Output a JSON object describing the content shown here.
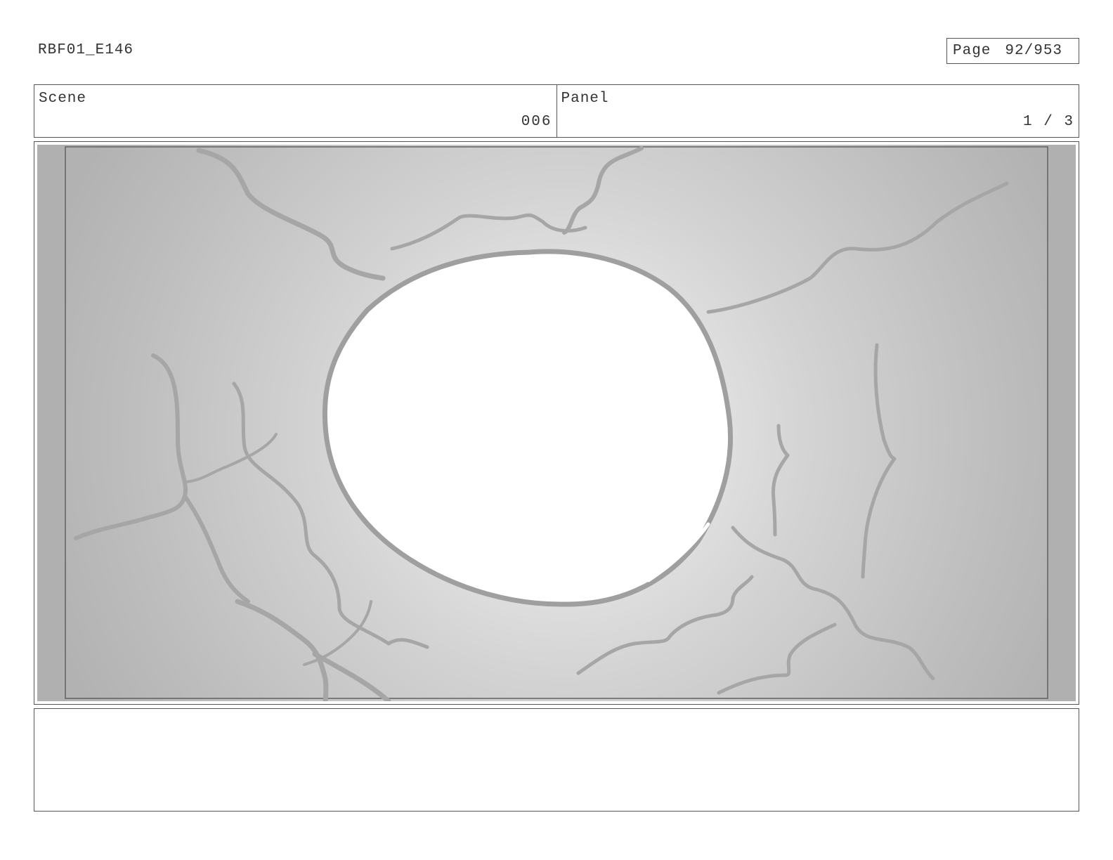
{
  "document": {
    "id": "RBF01_E146",
    "page_label": "Page",
    "page_number": "92/953"
  },
  "scene": {
    "label": "Scene",
    "value": "006"
  },
  "panel": {
    "label": "Panel",
    "value": "1 / 3"
  },
  "artwork": {
    "subject": "glowing-hole-with-cracks-icon",
    "colors": {
      "background": "#b0b0b0",
      "glow": "#ffffff",
      "cracks": "#9e9e9e",
      "safe_frame": "#555555"
    }
  },
  "notes": {
    "text": ""
  }
}
